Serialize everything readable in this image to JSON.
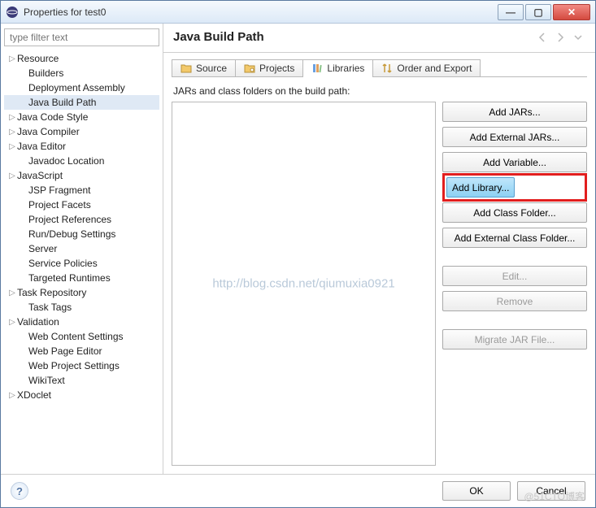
{
  "window": {
    "title": "Properties for test0"
  },
  "sidebar": {
    "filter_placeholder": "type filter text",
    "items": [
      {
        "label": "Resource",
        "expander": true,
        "indent": 0
      },
      {
        "label": "Builders",
        "expander": false,
        "indent": 1
      },
      {
        "label": "Deployment Assembly",
        "expander": false,
        "indent": 1
      },
      {
        "label": "Java Build Path",
        "expander": false,
        "indent": 1,
        "selected": true
      },
      {
        "label": "Java Code Style",
        "expander": true,
        "indent": 0
      },
      {
        "label": "Java Compiler",
        "expander": true,
        "indent": 0
      },
      {
        "label": "Java Editor",
        "expander": true,
        "indent": 0
      },
      {
        "label": "Javadoc Location",
        "expander": false,
        "indent": 1
      },
      {
        "label": "JavaScript",
        "expander": true,
        "indent": 0
      },
      {
        "label": "JSP Fragment",
        "expander": false,
        "indent": 1
      },
      {
        "label": "Project Facets",
        "expander": false,
        "indent": 1
      },
      {
        "label": "Project References",
        "expander": false,
        "indent": 1
      },
      {
        "label": "Run/Debug Settings",
        "expander": false,
        "indent": 1
      },
      {
        "label": "Server",
        "expander": false,
        "indent": 1
      },
      {
        "label": "Service Policies",
        "expander": false,
        "indent": 1
      },
      {
        "label": "Targeted Runtimes",
        "expander": false,
        "indent": 1
      },
      {
        "label": "Task Repository",
        "expander": true,
        "indent": 0
      },
      {
        "label": "Task Tags",
        "expander": false,
        "indent": 1
      },
      {
        "label": "Validation",
        "expander": true,
        "indent": 0
      },
      {
        "label": "Web Content Settings",
        "expander": false,
        "indent": 1
      },
      {
        "label": "Web Page Editor",
        "expander": false,
        "indent": 1
      },
      {
        "label": "Web Project Settings",
        "expander": false,
        "indent": 1
      },
      {
        "label": "WikiText",
        "expander": false,
        "indent": 1
      },
      {
        "label": "XDoclet",
        "expander": true,
        "indent": 0
      }
    ]
  },
  "header": {
    "title": "Java Build Path"
  },
  "tabs": {
    "source": "Source",
    "projects": "Projects",
    "libraries": "Libraries",
    "order": "Order and Export"
  },
  "panel": {
    "label": "JARs and class folders on the build path:",
    "watermark": "http://blog.csdn.net/qiumuxia0921"
  },
  "buttons": {
    "add_jars": "Add JARs...",
    "add_ext_jars": "Add External JARs...",
    "add_variable": "Add Variable...",
    "add_library": "Add Library...",
    "add_class_folder": "Add Class Folder...",
    "add_ext_class_folder": "Add External Class Folder...",
    "edit": "Edit...",
    "remove": "Remove",
    "migrate": "Migrate JAR File..."
  },
  "footer": {
    "ok": "OK",
    "cancel": "Cancel"
  },
  "corner_watermark": "@51CTO博客"
}
